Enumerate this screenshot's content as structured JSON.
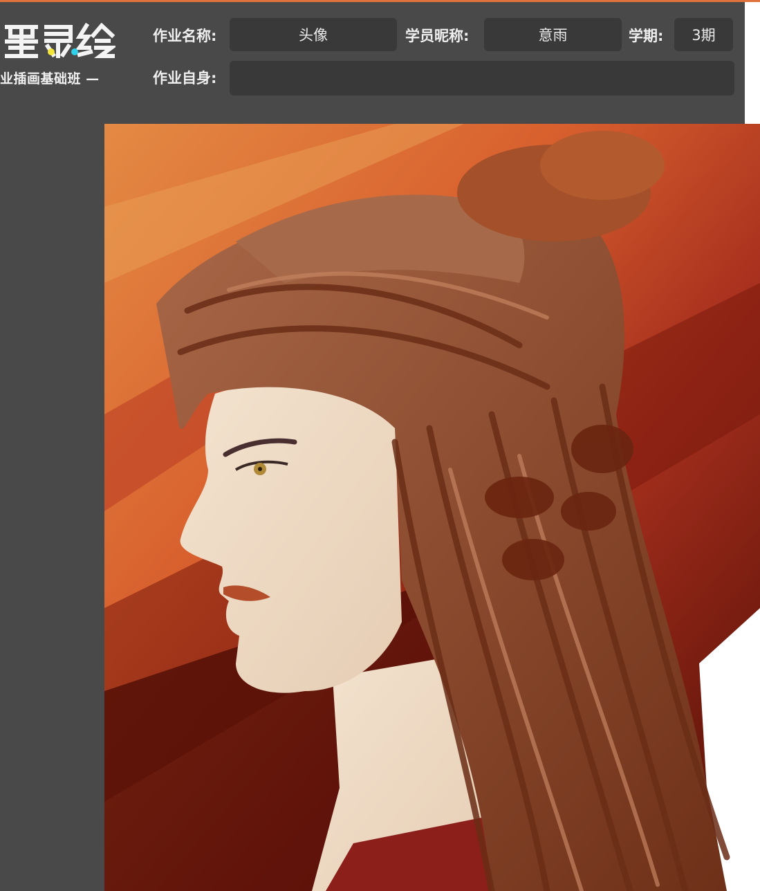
{
  "brand": {
    "logo_text": "墨灵绘",
    "course_text": "业插画基础班 —",
    "logo_colors": {
      "glyph": "#f4f4f4",
      "dot_yellow": "#f5e63a",
      "dot_cyan": "#2fd0ea"
    }
  },
  "form": {
    "assignment_name_label": "作业名称:",
    "assignment_name_value": "头像",
    "student_nickname_label": "学员昵称:",
    "student_nickname_value": "意雨",
    "term_label": "学期:",
    "term_value": "3期",
    "self_eval_label": "作业自身:",
    "self_eval_value": ""
  },
  "artwork": {
    "subject": "painted portrait of a figure in profile with long auburn hair",
    "palette": {
      "bg_orange": "#e0733c",
      "bg_red": "#a8301e",
      "bg_dark": "#5a0f05",
      "hair": "#8b4a2c",
      "skin": "#efdcc8"
    }
  }
}
